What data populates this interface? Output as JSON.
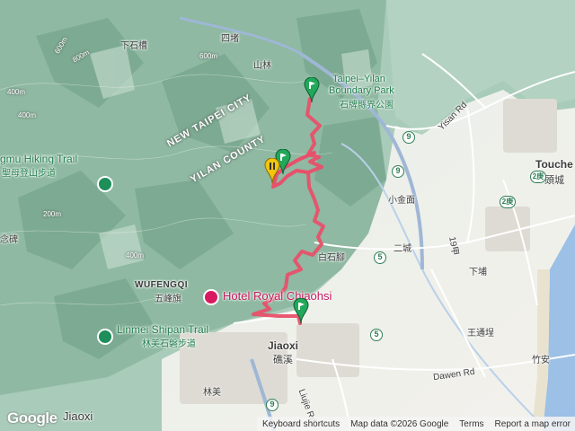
{
  "labels": {
    "sijiao": "四堵",
    "xia_shicao": "下石槽",
    "shanlin": "山林",
    "park_en_1": "Taipei–Yilan",
    "park_en_2": "Boundary Park",
    "park_zh": "石牌縣界公園",
    "new_taipei": "NEW TAIPEI CITY",
    "yilan_county": "YILAN COUNTY",
    "hiking_trail": "gmu Hiking Trail",
    "hiking_trail_zh": "聖母登山步道",
    "xiaojin": "小金面",
    "baishijiao": "白石腳",
    "ercheng": "二城",
    "xiabu": "下埔",
    "nianbei": "念碑",
    "wufengqi_en": "WUFENGQI",
    "wufengqi_zh": "五峰旗",
    "hotel": "Hotel Royal Chiaohsi",
    "linmei_en": "Linmei Shipan Trail",
    "linmei_zh": "林美石磐步道",
    "jiaoxi_en": "Jiaoxi",
    "jiaoxi_zh": "礁溪",
    "linmei": "林美",
    "jiaoxi_corner": "Jiaoxi",
    "wangtong": "王通埕",
    "dawen_rd": "Dawen Rd",
    "zhuan": "竹安",
    "liujie_rd": "Liujie Rd",
    "yisan_rd": "Yisan Rd",
    "touche_en": "Touche",
    "touche_zh": "頭城",
    "road_19": "19甲",
    "shield_9a": "9",
    "shield_9b": "9",
    "shield_9c": "9",
    "shield_5a": "5",
    "shield_5b": "5",
    "shield_2a": "2庚",
    "shield_2b": "2庚",
    "contour_1": "600m",
    "contour_2": "800m",
    "contour_3": "400m",
    "contour_4": "400m",
    "contour_5": "600m",
    "contour_6": "200m",
    "contour_7": "400m"
  },
  "footer": {
    "logo": "Google",
    "shortcuts": "Keyboard shortcuts",
    "mapdata": "Map data ©2026 Google",
    "terms": "Terms",
    "report": "Report a map error"
  },
  "colors": {
    "route": "#e8506a",
    "marker_green": "#22a85a",
    "marker_yellow": "#f2c40f",
    "poi_green": "#1e8e5a",
    "poi_pink": "#d81b60",
    "sea": "#9cc0e6",
    "road": "#ffffff",
    "highway": "#9fb7d6"
  },
  "icons": [
    "hiking-trail-icon",
    "hotel-icon",
    "route-start-marker",
    "route-end-marker",
    "waypoint-marker"
  ]
}
